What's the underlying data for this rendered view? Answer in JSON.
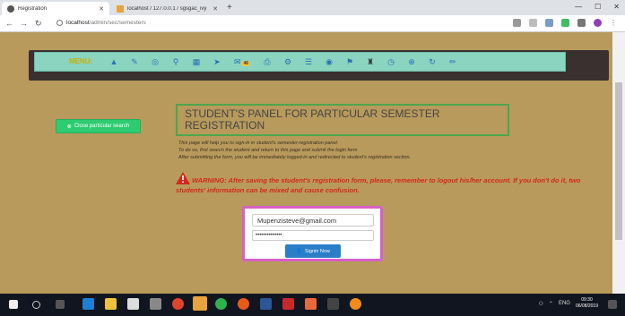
{
  "browser": {
    "tabs": [
      {
        "title": "Registration",
        "active": true
      },
      {
        "title": "localhost / 127.0.0.1 / sgsgac_ivy",
        "active": false
      }
    ],
    "new_tab": "+",
    "url_host": "localhost",
    "url_path": "/admin/sec/semesters"
  },
  "menu": {
    "label": "MENU:",
    "badge": "46",
    "icons": [
      "warning-icon",
      "wrench-icon",
      "circle-icon",
      "search-icon",
      "grid-icon",
      "send-icon",
      "envelope-icon",
      "print-icon",
      "gear-icon",
      "list-icon",
      "eye-icon",
      "flag-icon",
      "graduation-cap-icon",
      "clock-icon",
      "plus-circle-icon",
      "refresh-icon",
      "pencil-icon"
    ]
  },
  "close_button": {
    "label": "Close particular search"
  },
  "panel": {
    "title": "STUDENT'S PANEL FOR PARTICULAR SEMESTER REGISTRATION",
    "info_lines": [
      "This page will help you to sign-in in student's semester-registration panel.",
      "To do so, first search the student and return to this page and submit the login form",
      "After submitting the form, you will be immediately logged-in and redirected to student's registration section."
    ],
    "warning": "WARNING: After saving the student's registration form, please, remember to logout his/her account. If you don't do it, two students' information can be mixed and cause confusion."
  },
  "login": {
    "email_value": "Mupenzisteve@gmail.com",
    "password_value": "••••••••••••••",
    "signin_label": "Signin Now"
  },
  "taskbar": {
    "time": "09:30",
    "date": "06/08/2019",
    "lang": "ENG"
  },
  "colors": {
    "page_bg": "#b89a5c",
    "menu_bar": "#8ad4c0",
    "close_button": "#2ecc71",
    "warning": "#d4281c",
    "login_border": "#d660c8",
    "signin_button": "#2a7ec8"
  }
}
